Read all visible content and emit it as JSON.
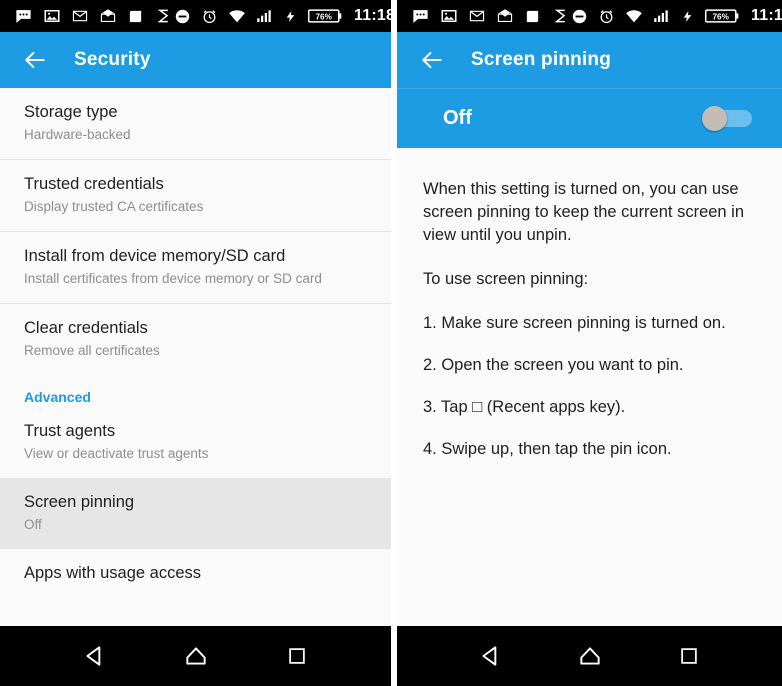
{
  "status_bar": {
    "icons": [
      "messages-icon",
      "photo-icon",
      "email-icon",
      "email-open-icon",
      "rounded-square-icon",
      "s-logo-icon",
      "do-not-disturb-icon",
      "alarm-clock-icon",
      "wifi-icon",
      "cellular-signal-icon",
      "charging-bolt-icon"
    ],
    "battery_percent": "76%",
    "time": "11:18"
  },
  "left_screen": {
    "appbar": {
      "back_icon": "back-arrow-icon",
      "title": "Security"
    },
    "list": [
      {
        "title": "Storage type",
        "subtitle": "Hardware-backed",
        "selected": false
      },
      {
        "title": "Trusted credentials",
        "subtitle": "Display trusted CA certificates",
        "selected": false
      },
      {
        "title": "Install from device memory/SD card",
        "subtitle": "Install certificates from device memory or SD card",
        "selected": false
      },
      {
        "title": "Clear credentials",
        "subtitle": "Remove all certificates",
        "selected": false
      }
    ],
    "advanced_header": "Advanced",
    "advanced_list": [
      {
        "title": "Trust agents",
        "subtitle": "View or deactivate trust agents",
        "selected": false
      },
      {
        "title": "Screen pinning",
        "subtitle": "Off",
        "selected": true
      },
      {
        "title": "Apps with usage access",
        "subtitle": "",
        "selected": false
      }
    ]
  },
  "right_screen": {
    "appbar": {
      "back_icon": "back-arrow-icon",
      "title": "Screen pinning"
    },
    "toggle": {
      "label": "Off",
      "state": "off"
    },
    "description": "When this setting is turned on, you can use screen pinning to keep the current screen in view until you unpin.",
    "intro": "To use screen pinning:",
    "steps": [
      "1. Make sure screen pinning is turned on.",
      "2. Open the screen you want to pin.",
      "3. Tap □ (Recent apps key).",
      "4. Swipe up, then tap the pin icon."
    ]
  },
  "nav_bar": {
    "back": "nav-back-icon",
    "home": "nav-home-icon",
    "recents": "nav-recents-icon"
  },
  "colors": {
    "accent_blue": "#1e9ce3",
    "toggle_bar_blue": "#1e9ce3",
    "selected_row": "#e6e6e6",
    "text_primary": "#1f1f1f",
    "text_secondary": "#8e8e8e"
  }
}
